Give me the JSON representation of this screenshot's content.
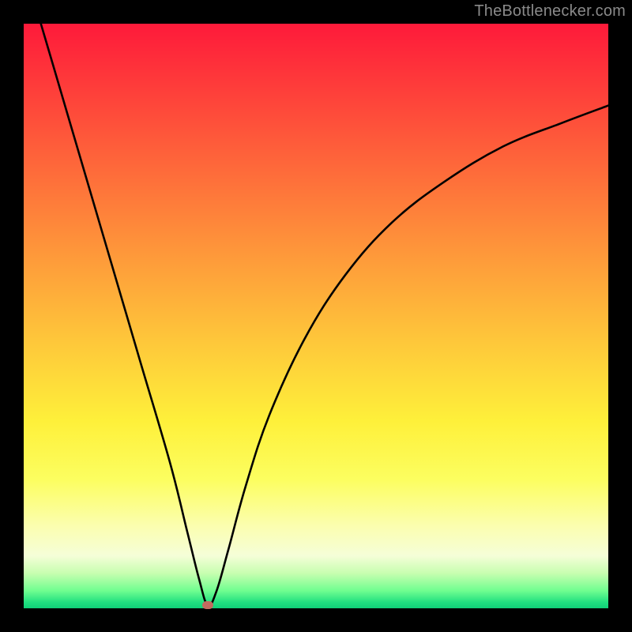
{
  "watermark": "TheBottlenecker.com",
  "chart_data": {
    "type": "line",
    "title": "",
    "xlabel": "",
    "ylabel": "",
    "xlim": [
      0,
      100
    ],
    "ylim": [
      0,
      100
    ],
    "series": [
      {
        "name": "bottleneck-curve",
        "x": [
          0,
          5,
          10,
          15,
          20,
          25,
          28,
          30,
          31.5,
          33,
          35,
          38,
          42,
          48,
          55,
          63,
          72,
          82,
          92,
          100
        ],
        "y": [
          110,
          93,
          76,
          59,
          42,
          25,
          13,
          5,
          0.5,
          3,
          10,
          21,
          33,
          46,
          57,
          66,
          73,
          79,
          83,
          86
        ]
      }
    ],
    "marker": {
      "x": 31.5,
      "y": 0.5
    },
    "gradient_stops": [
      {
        "pct": 0,
        "color": "#fe1a3a"
      },
      {
        "pct": 50,
        "color": "#fec93a"
      },
      {
        "pct": 80,
        "color": "#fcfe80"
      },
      {
        "pct": 100,
        "color": "#10d078"
      }
    ]
  }
}
